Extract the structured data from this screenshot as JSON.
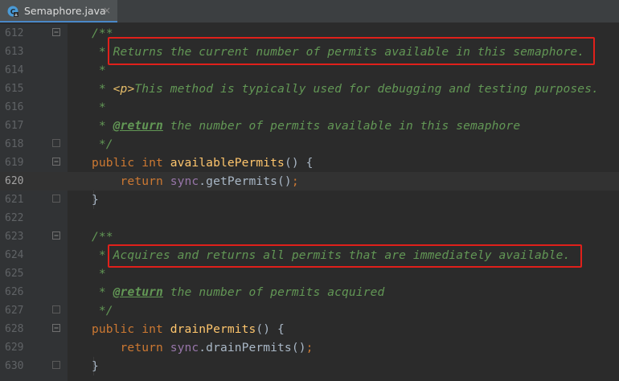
{
  "tab": {
    "label": "Semaphore.java",
    "close": "×",
    "icon": "java-class-icon"
  },
  "colors": {
    "background": "#2b2b2b",
    "gutter": "#313335",
    "comment": "#629755",
    "keyword": "#cc7832",
    "method": "#ffc66d",
    "field": "#9876aa",
    "highlight_box": "#e0201b"
  },
  "lines": [
    {
      "num": "612",
      "parts": [
        {
          "c": "tok-doc",
          "t": "/**"
        }
      ]
    },
    {
      "num": "613",
      "parts": [
        {
          "c": "tok-doc",
          "t": " * Returns the current number of permits available in this semaphore."
        }
      ]
    },
    {
      "num": "614",
      "parts": [
        {
          "c": "tok-doc",
          "t": " *"
        }
      ]
    },
    {
      "num": "615",
      "parts": [
        {
          "c": "tok-doc",
          "t": " * "
        },
        {
          "c": "tok-html",
          "t": "<p>"
        },
        {
          "c": "tok-doc",
          "t": "This method is typically used for debugging and testing purposes."
        }
      ]
    },
    {
      "num": "616",
      "parts": [
        {
          "c": "tok-doc",
          "t": " *"
        }
      ]
    },
    {
      "num": "617",
      "parts": [
        {
          "c": "tok-doc",
          "t": " * "
        },
        {
          "c": "tok-tag",
          "t": "@return"
        },
        {
          "c": "tok-doc",
          "t": " the number of permits available in this semaphore"
        }
      ]
    },
    {
      "num": "618",
      "parts": [
        {
          "c": "tok-doc",
          "t": " */"
        }
      ]
    },
    {
      "num": "619",
      "parts": [
        {
          "c": "tok-kw",
          "t": "public int "
        },
        {
          "c": "tok-method",
          "t": "availablePermits"
        },
        {
          "c": "tok-plain",
          "t": "() {"
        }
      ]
    },
    {
      "num": "620",
      "current": true,
      "parts": [
        {
          "c": "tok-kw",
          "t": "    return "
        },
        {
          "c": "tok-field",
          "t": "sync"
        },
        {
          "c": "tok-plain",
          "t": ".getPermits()"
        },
        {
          "c": "tok-semi",
          "t": ";"
        }
      ]
    },
    {
      "num": "621",
      "parts": [
        {
          "c": "tok-plain",
          "t": "}"
        }
      ]
    },
    {
      "num": "622",
      "parts": []
    },
    {
      "num": "623",
      "parts": [
        {
          "c": "tok-doc",
          "t": "/**"
        }
      ]
    },
    {
      "num": "624",
      "parts": [
        {
          "c": "tok-doc",
          "t": " * Acquires and returns all permits that are immediately available."
        }
      ]
    },
    {
      "num": "625",
      "parts": [
        {
          "c": "tok-doc",
          "t": " *"
        }
      ]
    },
    {
      "num": "626",
      "parts": [
        {
          "c": "tok-doc",
          "t": " * "
        },
        {
          "c": "tok-tag",
          "t": "@return"
        },
        {
          "c": "tok-doc",
          "t": " the number of permits acquired"
        }
      ]
    },
    {
      "num": "627",
      "parts": [
        {
          "c": "tok-doc",
          "t": " */"
        }
      ]
    },
    {
      "num": "628",
      "parts": [
        {
          "c": "tok-kw",
          "t": "public int "
        },
        {
          "c": "tok-method",
          "t": "drainPermits"
        },
        {
          "c": "tok-plain",
          "t": "() {"
        }
      ]
    },
    {
      "num": "629",
      "parts": [
        {
          "c": "tok-kw",
          "t": "    return "
        },
        {
          "c": "tok-field",
          "t": "sync"
        },
        {
          "c": "tok-plain",
          "t": ".drainPermits()"
        },
        {
          "c": "tok-semi",
          "t": ";"
        }
      ]
    },
    {
      "num": "630",
      "parts": [
        {
          "c": "tok-plain",
          "t": "}"
        }
      ]
    }
  ]
}
